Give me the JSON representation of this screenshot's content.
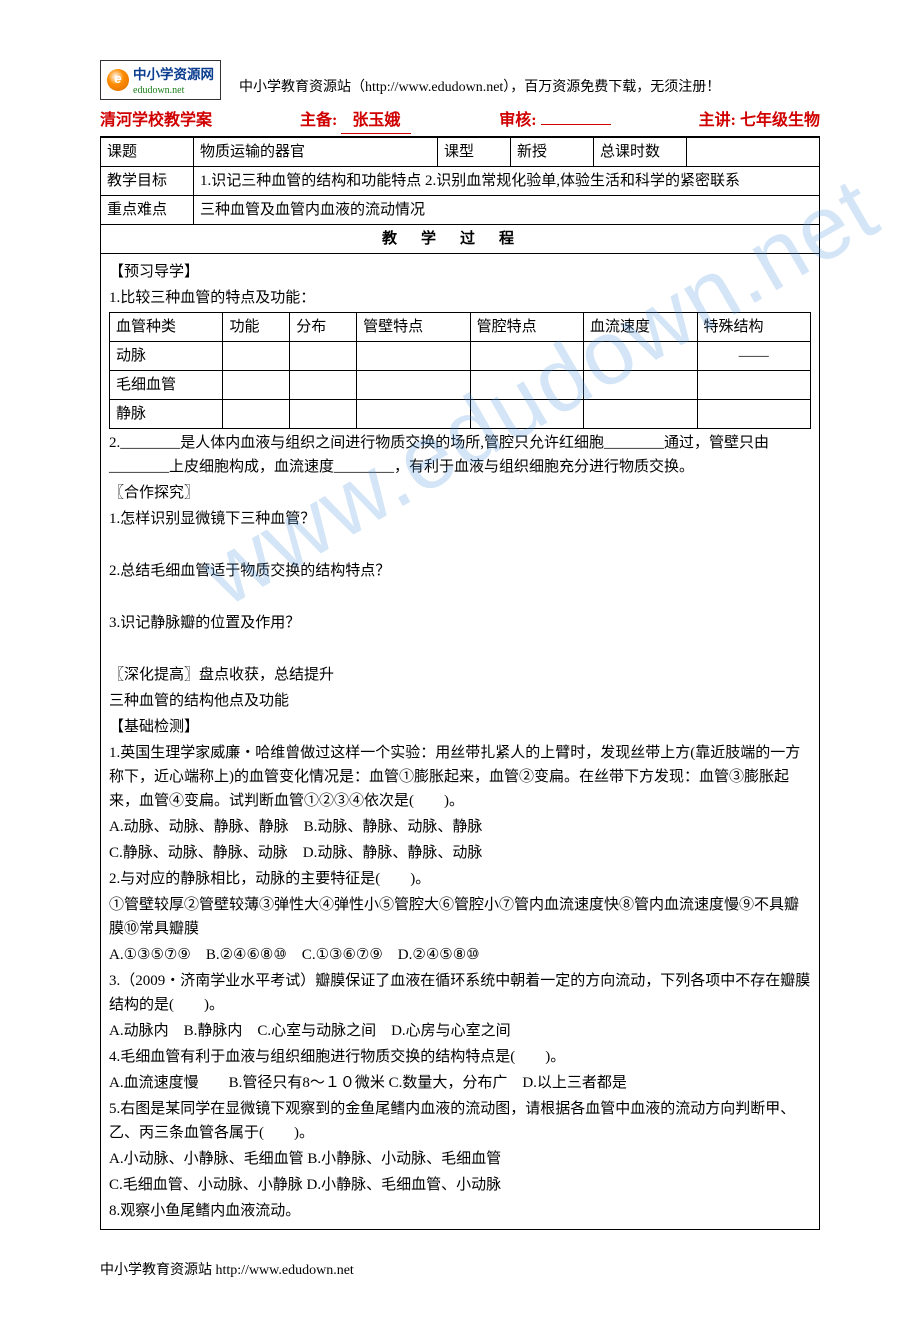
{
  "logo": {
    "brand_main": "中小学资源网",
    "brand_sub": "edudown.net"
  },
  "header_desc": "中小学教育资源站（http://www.edudown.net），百万资源免费下载，无须注册！",
  "title": {
    "school": "清河学校教学案",
    "prep_label": "主备:",
    "prep_name": "张玉娥",
    "review_label": "审核:",
    "review_name": "",
    "lecture_label": "主讲:",
    "lecture_name": "七年级生物"
  },
  "meta": {
    "topic_label": "课题",
    "topic": "物质运输的器官",
    "type_label": "课型",
    "type": "新授",
    "total_label": "总课时数",
    "total": "",
    "goal_label": "教学目标",
    "goal": "1.识记三种血管的结构和功能特点 2.识别血常规化验单,体验生活和科学的紧密联系",
    "diff_label": "重点难点",
    "diff": "三种血管及血管内血液的流动情况",
    "process_label": "教学过程"
  },
  "preview": {
    "heading": "【预习导学】",
    "item1": "1.比较三种血管的特点及功能：",
    "table_headers": [
      "血管种类",
      "功能",
      "分布",
      "管壁特点",
      "管腔特点",
      "血流速度",
      "特殊结构"
    ],
    "rows": [
      {
        "cells": [
          "动脉",
          "",
          "",
          "",
          "",
          "",
          "——"
        ]
      },
      {
        "cells": [
          "毛细血管",
          "",
          "",
          "",
          "",
          "",
          ""
        ]
      },
      {
        "cells": [
          "静脉",
          "",
          "",
          "",
          "",
          "",
          ""
        ]
      }
    ],
    "item2_pre": "2.________是人体内血液与组织之间进行物质交换的场所,管腔只允许红细胞________通过，管壁只由________上皮细胞构成，血流速度________，有利于血液与组织细胞充分进行物质交换。"
  },
  "coop": {
    "heading": "〖合作探究〗",
    "q1": "1.怎样识别显微镜下三种血管？",
    "q2": "2.总结毛细血管适于物质交换的结构特点？",
    "q3": "3.识记静脉瓣的位置及作用？"
  },
  "deep": {
    "heading": "〖深化提高〗盘点收获，总结提升",
    "line": "三种血管的结构他点及功能"
  },
  "base": {
    "heading": "【基础检测】",
    "q1a": "1.英国生理学家威廉・哈维曾做过这样一个实验：用丝带扎紧人的上臂时，发现丝带上方(靠近肢端的一方称下，近心端称上)的血管变化情况是：血管①膨胀起来，血管②变扁。在丝带下方发现：血管③膨胀起来，血管④变扁。试判断血管①②③④依次是(　　)。",
    "q1b": "A.动脉、动脉、静脉、静脉　B.动脉、静脉、动脉、静脉",
    "q1c": "C.静脉、动脉、静脉、动脉　D.动脉、静脉、静脉、动脉",
    "q2a": "2.与对应的静脉相比，动脉的主要特征是(　　)。",
    "q2b": "①管壁较厚②管壁较薄③弹性大④弹性小⑤管腔大⑥管腔小⑦管内血流速度快⑧管内血流速度慢⑨不具瓣膜⑩常具瓣膜",
    "q2c": "A.①③⑤⑦⑨　B.②④⑥⑧⑩　C.①③⑥⑦⑨　D.②④⑤⑧⑩",
    "q3a": "3.（2009・济南学业水平考试）瓣膜保证了血液在循环系统中朝着一定的方向流动，下列各项中不存在瓣膜结构的是(　　)。",
    "q3b": "A.动脉内　B.静脉内　C.心室与动脉之间　D.心房与心室之间",
    "q4a": "4.毛细血管有利于血液与组织细胞进行物质交换的结构特点是(　　)。",
    "q4b": "A.血流速度慢　　B.管径只有8～１０微米 C.数量大，分布广　D.以上三者都是",
    "q5a": "5.右图是某同学在显微镜下观察到的金鱼尾鳍内血液的流动图，请根据各血管中血液的流动方向判断甲、乙、丙三条血管各属于(　　)。",
    "q5b": "A.小动脉、小静脉、毛细血管 B.小静脉、小动脉、毛细血管",
    "q5c": "C.毛细血管、小动脉、小静脉 D.小静脉、毛细血管、小动脉",
    "q8": "8.观察小鱼尾鳍内血液流动。"
  },
  "footer": "中小学教育资源站 http://www.edudown.net",
  "watermark": "www.edudown.net"
}
